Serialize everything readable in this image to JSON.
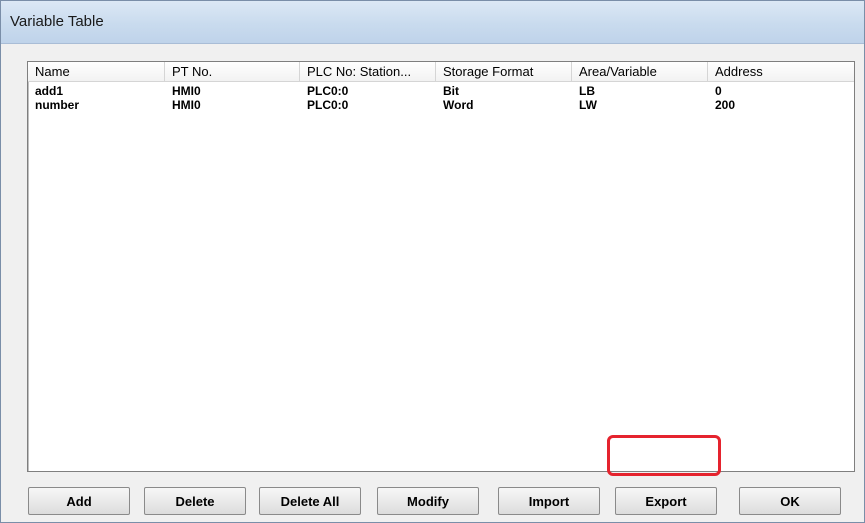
{
  "window": {
    "title": "Variable Table"
  },
  "table": {
    "columns": [
      "Name",
      "PT No.",
      "PLC No: Station...",
      "Storage Format",
      "Area/Variable",
      "Address"
    ],
    "rows": [
      [
        "add1",
        "HMI0",
        "PLC0:0",
        "Bit",
        "LB",
        "0"
      ],
      [
        "number",
        "HMI0",
        "PLC0:0",
        "Word",
        "LW",
        "200"
      ]
    ]
  },
  "buttons": {
    "add": "Add",
    "delete": "Delete",
    "delete_all": "Delete All",
    "modify": "Modify",
    "import": "Import",
    "export": "Export",
    "ok": "OK"
  },
  "colors": {
    "highlight": "#e5232e",
    "titlebar": "#c9dbee"
  }
}
